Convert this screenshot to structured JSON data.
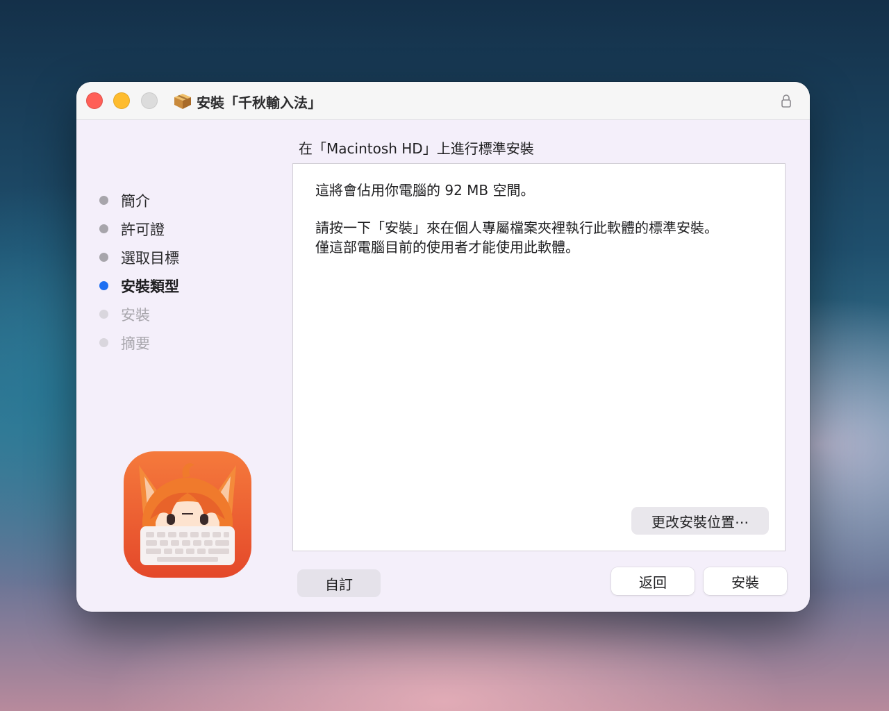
{
  "window": {
    "title": "安裝「千秋輸入法」",
    "title_icon": "package-icon",
    "lock_icon": "lock-icon"
  },
  "steps": [
    {
      "label": "簡介",
      "state": "done"
    },
    {
      "label": "許可證",
      "state": "done"
    },
    {
      "label": "選取目標",
      "state": "done"
    },
    {
      "label": "安裝類型",
      "state": "current"
    },
    {
      "label": "安裝",
      "state": "future"
    },
    {
      "label": "摘要",
      "state": "future"
    }
  ],
  "content": {
    "heading": "在「Macintosh HD」上進行標準安裝",
    "paragraph1": "這將會佔用你電腦的 92 MB 空間。",
    "paragraph2_line1": "請按一下「安裝」來在個人專屬檔案夾裡執行此軟體的標準安裝。",
    "paragraph2_line2": "僅這部電腦目前的使用者才能使用此軟體。",
    "change_location_button": "更改安裝位置⋯"
  },
  "buttons": {
    "customize": "自訂",
    "back": "返回",
    "install": "安裝"
  },
  "colors": {
    "accent": "#1d6ff2",
    "close": "#ff5f57",
    "minimize": "#febc2e",
    "zoom": "#dcdcdc",
    "logo_orange": "#ee5a2a"
  }
}
